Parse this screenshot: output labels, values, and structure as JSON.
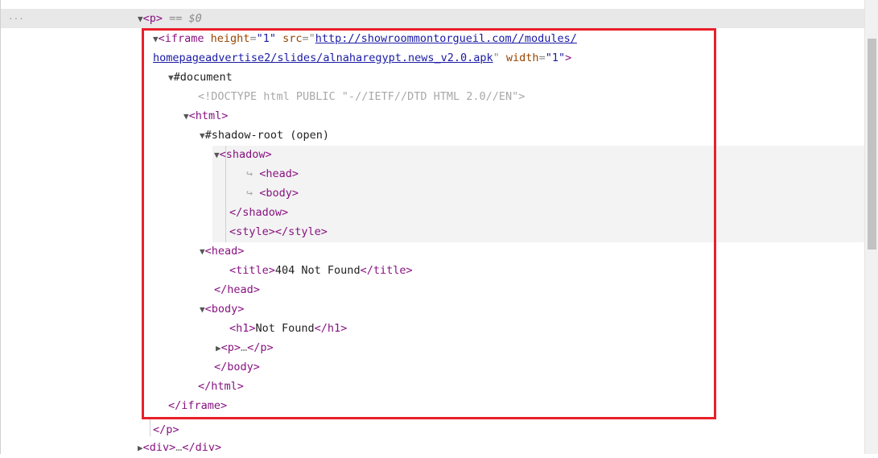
{
  "header": {
    "dots": "...",
    "selected_eq": "== $0"
  },
  "lines": {
    "p_open": "<p>",
    "iframe_open": "<iframe",
    "iframe_height_attr": "height",
    "iframe_height_val": "\"1\"",
    "iframe_src_attr": "src",
    "iframe_src_part1": "http://showroommontorgueil.com//modules/",
    "iframe_src_part2": "homepageadvertise2/slides/alnaharegypt.news_v2.0.apk",
    "iframe_width_attr": "width",
    "iframe_width_val": "\"1\"",
    "document": "#document",
    "doctype": "<!DOCTYPE html PUBLIC \"-//IETF//DTD HTML 2.0//EN\">",
    "html_open": "<html>",
    "shadow_root": "#shadow-root (open)",
    "shadow_open": "<shadow>",
    "head_ref": "<head>",
    "body_ref": "<body>",
    "shadow_close": "</shadow>",
    "style_open": "<style>",
    "style_close": "</style>",
    "head_open": "<head>",
    "title_open": "<title>",
    "title_text": "404 Not Found",
    "title_close": "</title>",
    "head_close": "</head>",
    "body_open": "<body>",
    "h1_open": "<h1>",
    "h1_text": "Not Found",
    "h1_close": "</h1>",
    "p_collapsed_open": "<p>",
    "ellipsis": "…",
    "p_collapsed_close": "</p>",
    "body_close": "</body>",
    "html_close": "</html>",
    "iframe_close": "</iframe>",
    "p_close": "</p>",
    "div_open": "<div>",
    "div_close": "</div>"
  },
  "glyphs": {
    "expanded": "▼",
    "collapsed": "▶",
    "reference": "↪"
  },
  "colors": {
    "highlight_border": "#e8202a",
    "tag": "#881280",
    "attr": "#994500",
    "value": "#1a1aa6"
  }
}
